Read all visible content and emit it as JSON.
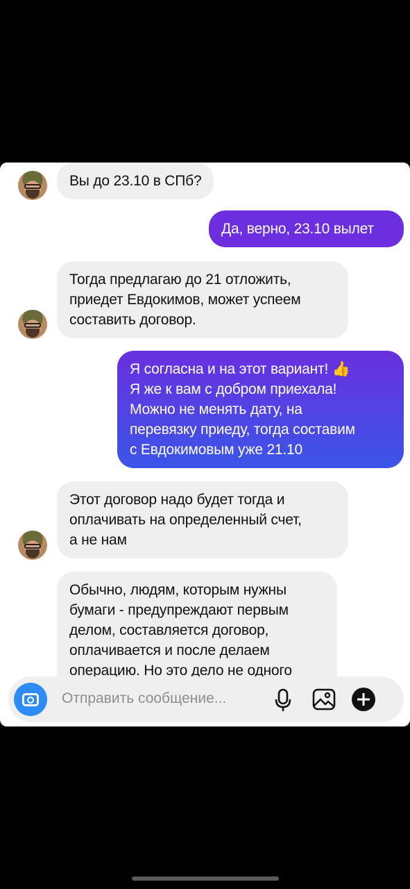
{
  "messages": [
    {
      "from": "them",
      "lines": [
        "Вы до 23.10 в СПб?"
      ]
    },
    {
      "from": "me",
      "lines": [
        "Да, верно, 23.10 вылет"
      ]
    },
    {
      "from": "them",
      "lines": [
        "Тогда предлагаю до 21 отложить,",
        "приедет Евдокимов, может успеем",
        "составить договор."
      ]
    },
    {
      "from": "me",
      "lines": [
        "Я согласна и на этот вариант! 👍",
        "Я же к вам с добром приехала!",
        "Можно не менять дату, на",
        "перевязку приеду, тогда составим",
        "с Евдокимовым уже 21.10"
      ]
    },
    {
      "from": "them",
      "lines": [
        "Этот договор надо будет тогда и",
        "оплачивать на определенный счет,",
        "а не нам"
      ]
    },
    {
      "from": "them",
      "lines": [
        "Обычно, людям, которым нужны",
        "бумаги - предупреждают первым",
        "делом, составляется договор,",
        "оплачивается и после делаем",
        "операцию. Но это дело не одного"
      ]
    }
  ],
  "composer": {
    "placeholder": "Отправить сообщение...",
    "icons": [
      "camera-icon",
      "microphone-icon",
      "image-icon",
      "plus-icon"
    ]
  },
  "colors": {
    "incoming_bubble": "#efefef",
    "outgoing_top": "#6a2fe0",
    "outgoing_bottom": "#3a55e8",
    "camera_button": "#2d8cf5"
  }
}
